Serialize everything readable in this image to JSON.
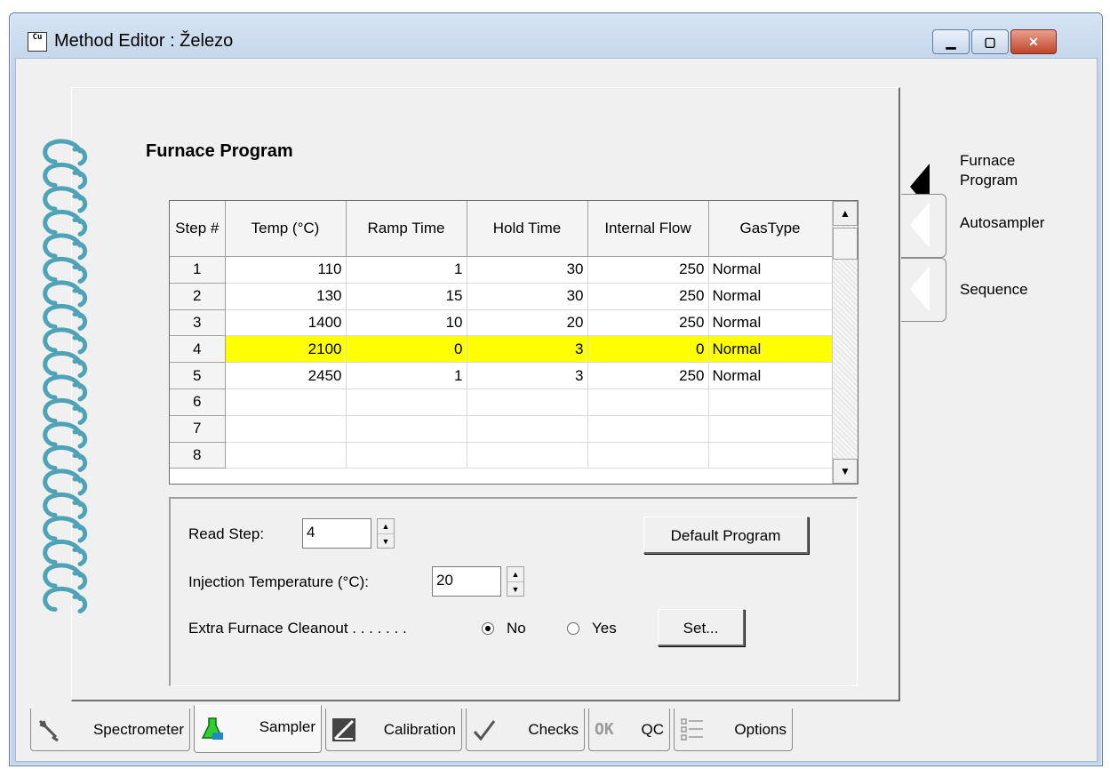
{
  "window": {
    "title": "Method Editor : Železo",
    "app_icon": "Cu",
    "buttons": {
      "minimize": "minimize-icon",
      "maximize": "maximize-icon",
      "close": "close-icon"
    }
  },
  "section_title": "Furnace Program",
  "grid": {
    "columns": [
      "Step #",
      "Temp (°C)",
      "Ramp Time",
      "Hold Time",
      "Internal Flow",
      "GasType"
    ],
    "rows": [
      {
        "step": "1",
        "temp": "110",
        "ramp": "1",
        "hold": "30",
        "flow": "250",
        "gas": "Normal"
      },
      {
        "step": "2",
        "temp": "130",
        "ramp": "15",
        "hold": "30",
        "flow": "250",
        "gas": "Normal"
      },
      {
        "step": "3",
        "temp": "1400",
        "ramp": "10",
        "hold": "20",
        "flow": "250",
        "gas": "Normal"
      },
      {
        "step": "4",
        "temp": "2100",
        "ramp": "0",
        "hold": "3",
        "flow": "0",
        "gas": "Normal"
      },
      {
        "step": "5",
        "temp": "2450",
        "ramp": "1",
        "hold": "3",
        "flow": "250",
        "gas": "Normal"
      },
      {
        "step": "6",
        "temp": "",
        "ramp": "",
        "hold": "",
        "flow": "",
        "gas": ""
      },
      {
        "step": "7",
        "temp": "",
        "ramp": "",
        "hold": "",
        "flow": "",
        "gas": ""
      },
      {
        "step": "8",
        "temp": "",
        "ramp": "",
        "hold": "",
        "flow": "",
        "gas": ""
      }
    ],
    "highlight_color": "#ffff00"
  },
  "options": {
    "read_step_label": "Read Step:",
    "read_step_value": "4",
    "injection_label": "Injection Temperature (°C):",
    "injection_value": "20",
    "cleanout_label": "Extra Furnace Cleanout . . . . . . .",
    "radio_no": "No",
    "radio_yes": "Yes",
    "selected": "No",
    "default_program_button": "Default Program",
    "set_button": "Set..."
  },
  "right_tabs": [
    {
      "label": "Furnace\nProgram",
      "active": true
    },
    {
      "label": "Autosampler",
      "active": false
    },
    {
      "label": "Sequence",
      "active": false
    }
  ],
  "bottom_tabs": [
    {
      "label": "Spectrometer",
      "icon": "wrench-icon"
    },
    {
      "label": "Sampler",
      "icon": "flask-icon",
      "active": true
    },
    {
      "label": "Calibration",
      "icon": "chart-icon"
    },
    {
      "label": "Checks",
      "icon": "checkmark-icon"
    },
    {
      "label": "QC",
      "icon": "ok-icon",
      "icon_text": "OK"
    },
    {
      "label": "Options",
      "icon": "list-icon"
    }
  ],
  "colors": {
    "selection": "#ffff00",
    "ring": "#4fa3b6",
    "active_tab_arrow": "#000000"
  }
}
